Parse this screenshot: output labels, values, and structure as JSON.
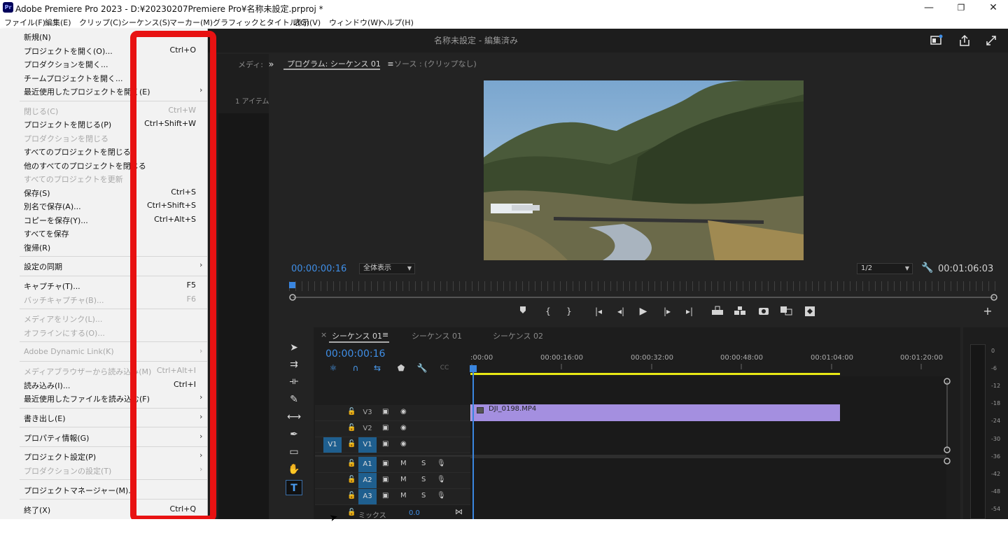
{
  "window": {
    "title": "Adobe Premiere Pro 2023 - D:¥20230207Premiere Pro¥名称未設定.prproj *",
    "logo": "Pr",
    "minimize": "—",
    "maximize": "❐",
    "close": "✕"
  },
  "menubar": [
    "ファイル(F)",
    "編集(E)",
    "クリップ(C)",
    "シーケンス(S)",
    "マーカー(M)",
    "グラフィックとタイトル(G)",
    "表示(V)",
    "ウィンドウ(W)",
    "ヘルプ(H)"
  ],
  "header": {
    "doc_title": "名称未設定 - 編集済み",
    "icons": [
      "workspace-icon",
      "share-icon",
      "fullscreen-icon"
    ]
  },
  "file_menu": [
    {
      "label": "新規(N)",
      "shortcut": "",
      "submenu": true,
      "disabled": false
    },
    {
      "label": "プロジェクトを開く(O)...",
      "shortcut": "Ctrl+O",
      "submenu": false,
      "disabled": false
    },
    {
      "label": "プロダクションを開く...",
      "shortcut": "",
      "submenu": false,
      "disabled": false
    },
    {
      "label": "チームプロジェクトを開く...",
      "shortcut": "",
      "submenu": false,
      "disabled": false
    },
    {
      "label": "最近使用したプロジェクトを開く(E)",
      "shortcut": "",
      "submenu": true,
      "disabled": false
    },
    {
      "label": "閉じる(C)",
      "shortcut": "Ctrl+W",
      "submenu": false,
      "disabled": true
    },
    {
      "label": "プロジェクトを閉じる(P)",
      "shortcut": "Ctrl+Shift+W",
      "submenu": false,
      "disabled": false
    },
    {
      "label": "プロダクションを閉じる",
      "shortcut": "",
      "submenu": false,
      "disabled": true
    },
    {
      "label": "すべてのプロジェクトを閉じる",
      "shortcut": "",
      "submenu": false,
      "disabled": false
    },
    {
      "label": "他のすべてのプロジェクトを閉じる",
      "shortcut": "",
      "submenu": false,
      "disabled": false
    },
    {
      "label": "すべてのプロジェクトを更新",
      "shortcut": "",
      "submenu": false,
      "disabled": true
    },
    {
      "label": "保存(S)",
      "shortcut": "Ctrl+S",
      "submenu": false,
      "disabled": false
    },
    {
      "label": "別名で保存(A)...",
      "shortcut": "Ctrl+Shift+S",
      "submenu": false,
      "disabled": false
    },
    {
      "label": "コピーを保存(Y)...",
      "shortcut": "Ctrl+Alt+S",
      "submenu": false,
      "disabled": false
    },
    {
      "label": "すべてを保存",
      "shortcut": "",
      "submenu": false,
      "disabled": false
    },
    {
      "label": "復帰(R)",
      "shortcut": "",
      "submenu": false,
      "disabled": false
    },
    {
      "label": "設定の同期",
      "shortcut": "",
      "submenu": true,
      "disabled": false
    },
    {
      "label": "キャプチャ(T)...",
      "shortcut": "F5",
      "submenu": false,
      "disabled": false
    },
    {
      "label": "バッチキャプチャ(B)...",
      "shortcut": "F6",
      "submenu": false,
      "disabled": true
    },
    {
      "label": "メディアをリンク(L)...",
      "shortcut": "",
      "submenu": false,
      "disabled": true
    },
    {
      "label": "オフラインにする(O)...",
      "shortcut": "",
      "submenu": false,
      "disabled": true
    },
    {
      "label": "Adobe Dynamic Link(K)",
      "shortcut": "",
      "submenu": true,
      "disabled": true
    },
    {
      "label": "メディアブラウザーから読み込み(M)",
      "shortcut": "Ctrl+Alt+I",
      "submenu": false,
      "disabled": true
    },
    {
      "label": "読み込み(I)...",
      "shortcut": "Ctrl+I",
      "submenu": false,
      "disabled": false
    },
    {
      "label": "最近使用したファイルを読み込む(F)",
      "shortcut": "",
      "submenu": true,
      "disabled": false
    },
    {
      "label": "書き出し(E)",
      "shortcut": "",
      "submenu": true,
      "disabled": false
    },
    {
      "label": "プロパティ情報(G)",
      "shortcut": "",
      "submenu": true,
      "disabled": false
    },
    {
      "label": "プロジェクト設定(P)",
      "shortcut": "",
      "submenu": true,
      "disabled": false
    },
    {
      "label": "プロダクションの設定(T)",
      "shortcut": "",
      "submenu": true,
      "disabled": true
    },
    {
      "label": "プロジェクトマネージャー(M)...",
      "shortcut": "",
      "submenu": false,
      "disabled": false
    },
    {
      "label": "終了(X)",
      "shortcut": "Ctrl+Q",
      "submenu": false,
      "disabled": false
    }
  ],
  "submenu_arrow": "›",
  "media_panel": {
    "tab": "メディ:",
    "expand": "»",
    "items": "1 アイテム"
  },
  "program_monitor": {
    "tab": "プログラム: シーケンス 01",
    "tab_menu": "≡",
    "source_tab": "ソース : (クリップなし)",
    "timecode": "00:00:00:16",
    "zoom": "全体表示",
    "resolution": "1/2",
    "duration": "00:01:06:03",
    "controls": [
      "marker-icon",
      "mark-in-icon",
      "mark-out-icon",
      "go-to-in-icon",
      "step-back-icon",
      "play-icon",
      "step-forward-icon",
      "go-to-out-icon",
      "lift-icon",
      "extract-icon",
      "export-frame-icon",
      "comparison-view-icon",
      "toggle-proxies-icon"
    ],
    "add": "+"
  },
  "timeline": {
    "close": "×",
    "tabs": [
      "シーケンス 01",
      "シーケンス 01",
      "シーケンス 02"
    ],
    "tab_menu": "≡",
    "timecode": "00:00:00:16",
    "ruler": [
      ":00:00",
      "00:00:16:00",
      "00:00:32:00",
      "00:00:48:00",
      "00:01:04:00",
      "00:01:20:00"
    ],
    "clip_name": "DJI_0198.MP4",
    "tracks": [
      {
        "source": "",
        "name": "V3",
        "target": false,
        "icon2": "eye"
      },
      {
        "source": "",
        "name": "V2",
        "target": false,
        "icon2": "eye"
      },
      {
        "source": "V1",
        "name": "V1",
        "target": true,
        "icon2": "eye"
      },
      {
        "source": "",
        "name": "A1",
        "target": true,
        "icon2": "M"
      },
      {
        "source": "",
        "name": "A2",
        "target": true,
        "icon2": "M"
      },
      {
        "source": "",
        "name": "A3",
        "target": true,
        "icon2": "M"
      }
    ],
    "mix_label": "ミックス",
    "mix_value": "0.0"
  },
  "audio_meter": [
    "0",
    "-6",
    "-12",
    "-18",
    "-24",
    "-30",
    "-36",
    "-42",
    "-48",
    "-54"
  ],
  "colors": {
    "accent": "#3f8ee6",
    "clip": "#a48fe0",
    "highlight": "#e81212",
    "work_area": "#e8e815"
  }
}
